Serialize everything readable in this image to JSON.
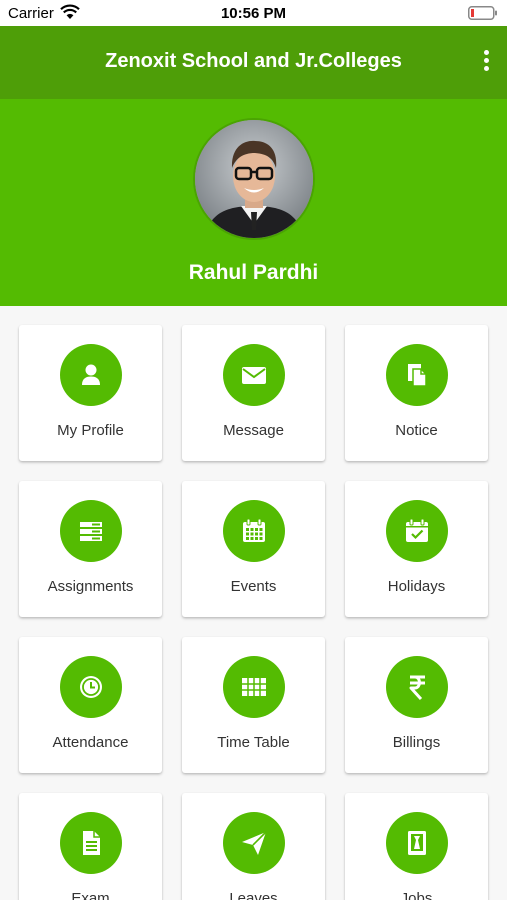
{
  "status_bar": {
    "carrier": "Carrier",
    "time": "10:56 PM"
  },
  "app_bar": {
    "title": "Zenoxit School and Jr.Colleges"
  },
  "profile": {
    "name": "Rahul Pardhi"
  },
  "colors": {
    "primary": "#54bb02",
    "app_bar": "#4e9e08",
    "battery_low": "#e53935"
  },
  "tiles": [
    {
      "label": "My Profile",
      "icon": "user-icon"
    },
    {
      "label": "Message",
      "icon": "envelope-icon"
    },
    {
      "label": "Notice",
      "icon": "documents-icon"
    },
    {
      "label": "Assignments",
      "icon": "stacked-list-icon"
    },
    {
      "label": "Events",
      "icon": "calendar-grid-icon"
    },
    {
      "label": "Holidays",
      "icon": "calendar-check-icon"
    },
    {
      "label": "Attendance",
      "icon": "clock-icon"
    },
    {
      "label": "Time Table",
      "icon": "table-icon"
    },
    {
      "label": "Billings",
      "icon": "rupee-icon"
    },
    {
      "label": "Exam",
      "icon": "document-icon"
    },
    {
      "label": "Leaves",
      "icon": "paper-plane-icon"
    },
    {
      "label": "Jobs",
      "icon": "id-badge-icon"
    }
  ]
}
